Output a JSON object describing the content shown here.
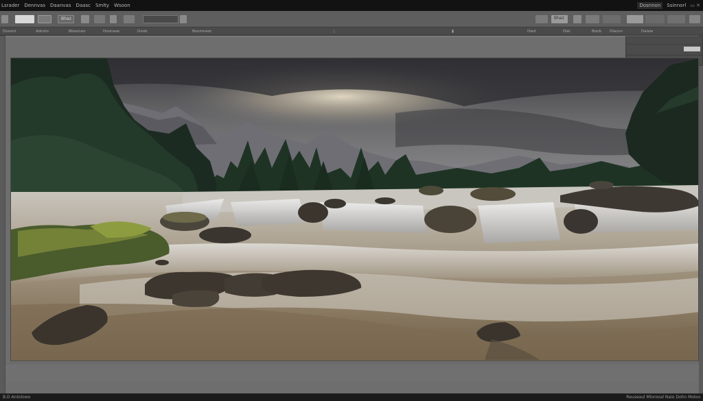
{
  "menu": {
    "items": [
      "Lsrader",
      "Dennvas",
      "Daanvas",
      "Daasc",
      "Smlty",
      "Wsoon"
    ],
    "workspace_label": "Dosnnon",
    "workspace_label2": "Ssinnorl"
  },
  "toolbar": {
    "home_label": "Bhaz",
    "view_label": "Bhaz"
  },
  "options": {
    "labels": [
      "Doosnt",
      "Adnsto",
      "Bbaoneo",
      "Doonase",
      "Doob",
      "Boomneor"
    ],
    "right_labels": [
      "Dwd",
      "Dlel",
      "Boob",
      "Dlacon",
      "Dalaie"
    ]
  },
  "status": {
    "left": "B.D  Antolowo",
    "right": "Reuseaul  Mlorooal  Naio  Dohn  Moloo"
  },
  "colors": {
    "menubar": "#121212",
    "toolbar": "#5e5e5e",
    "workspace": "#6e6e6e",
    "statusbar": "#1b1b1b"
  }
}
